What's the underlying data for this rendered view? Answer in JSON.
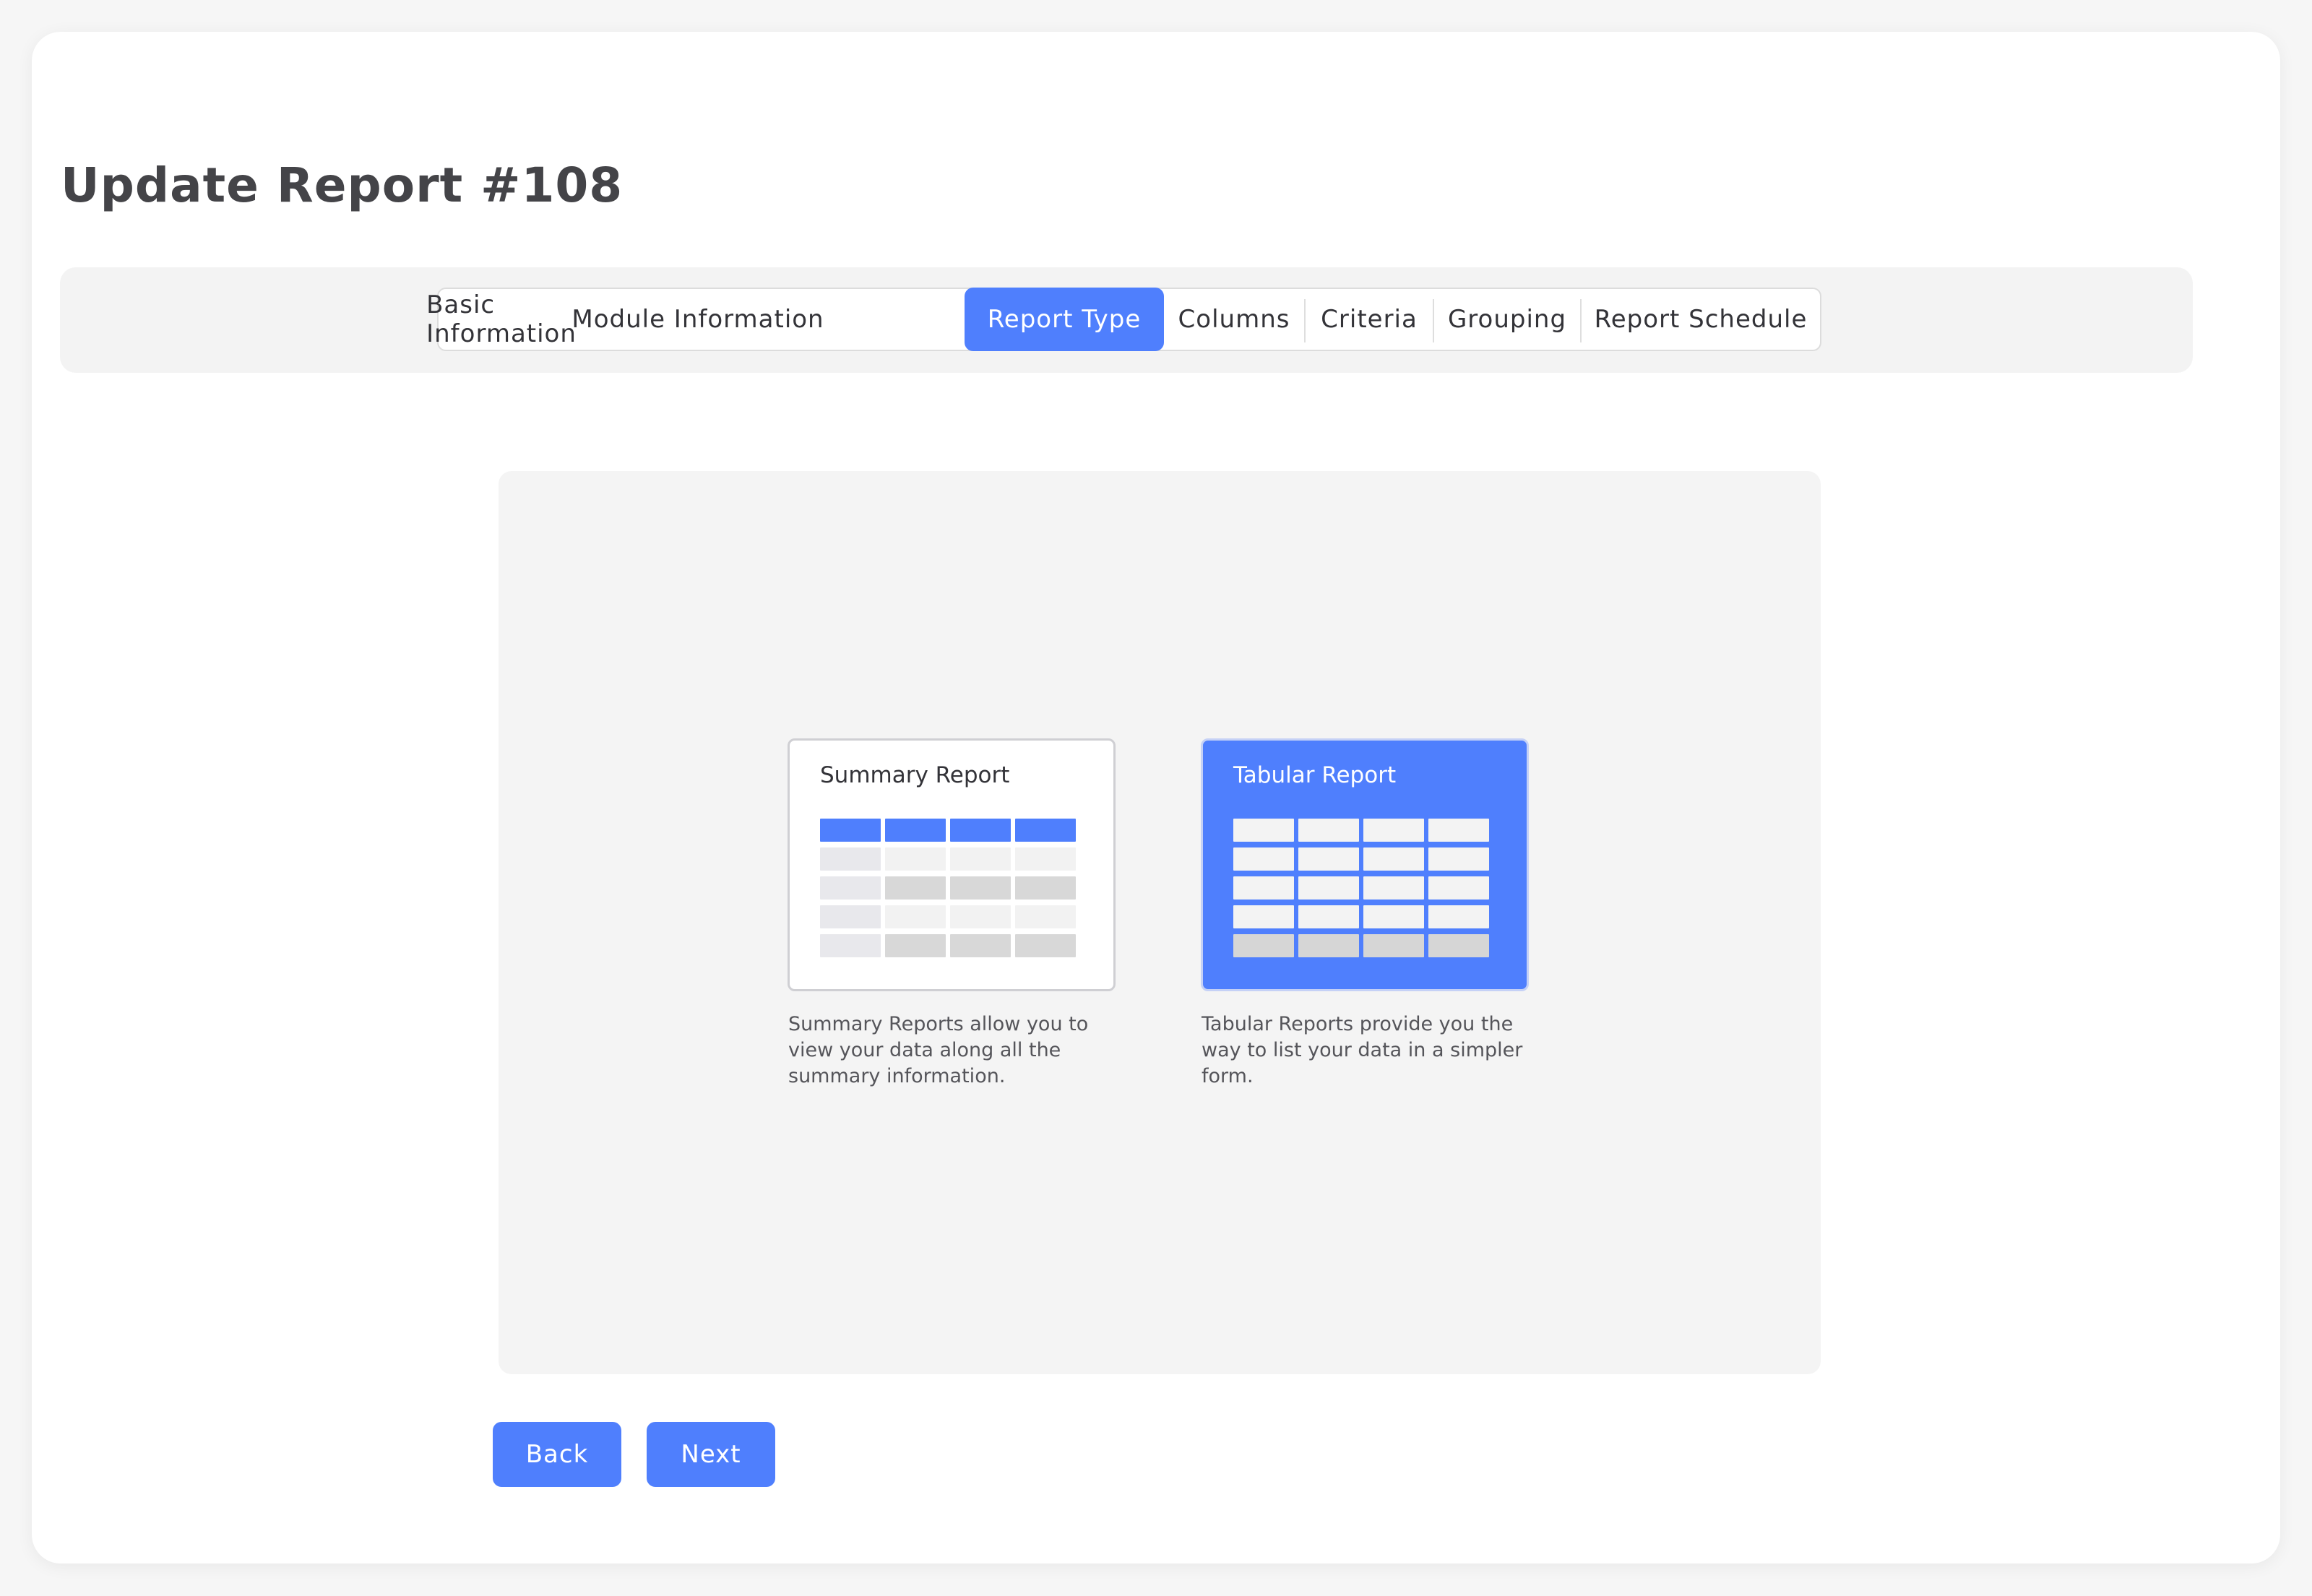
{
  "page": {
    "title": "Update Report #108"
  },
  "tabs": [
    {
      "label": "Basic Information",
      "active": false
    },
    {
      "label": "Module Information",
      "active": false
    },
    {
      "label": "Report Type",
      "active": true
    },
    {
      "label": "Columns",
      "active": false
    },
    {
      "label": "Criteria",
      "active": false
    },
    {
      "label": "Grouping",
      "active": false
    },
    {
      "label": "Report Schedule",
      "active": false
    }
  ],
  "report_types": [
    {
      "title": "Summary Report",
      "description": "Summary Reports allow you to view your data along all the summary information.",
      "selected": false,
      "icon": "summary-table-icon"
    },
    {
      "title": "Tabular Report",
      "description": "Tabular Reports provide you the way to list your data in a simpler form.",
      "selected": true,
      "icon": "tabular-table-icon"
    }
  ],
  "actions": {
    "back_label": "Back",
    "next_label": "Next"
  },
  "colors": {
    "accent": "#4f7ffd",
    "panel": "#f4f4f4",
    "text": "#444448"
  }
}
